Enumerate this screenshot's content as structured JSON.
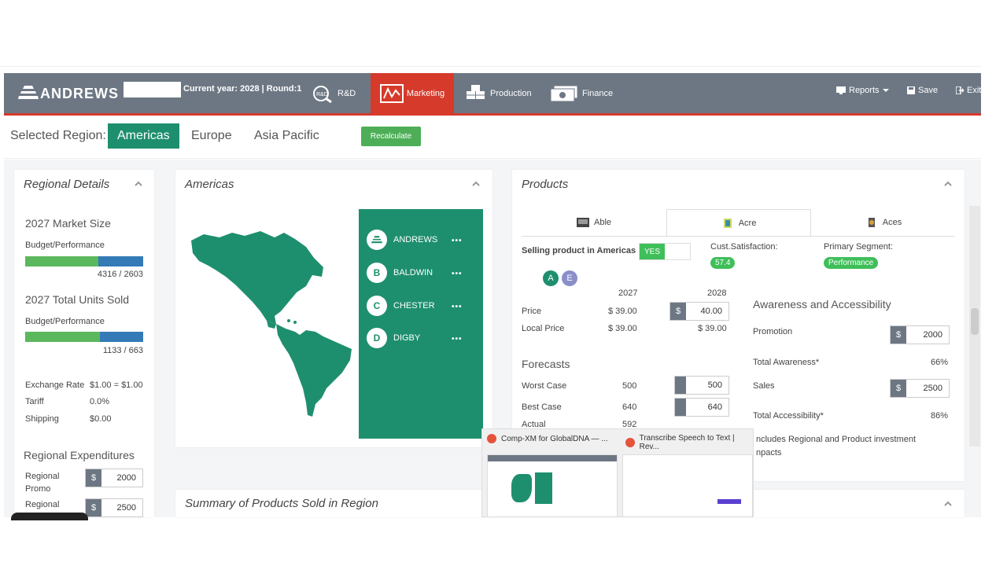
{
  "nav": {
    "logo": "ANDREWS",
    "current_year": "Current year: 2028 | Round:1",
    "items": [
      {
        "label": "R&D",
        "icon": "rd-icon"
      },
      {
        "label": "Marketing",
        "icon": "marketing-icon"
      },
      {
        "label": "Production",
        "icon": "boxes-icon"
      },
      {
        "label": "Finance",
        "icon": "money-icon"
      }
    ],
    "reports": "Reports",
    "save": "Save",
    "exit": "Exit",
    "brand_color": "#6d7784",
    "accent_color": "#d63a2a"
  },
  "region": {
    "label": "Selected Region:",
    "tabs": [
      "Americas",
      "Europe",
      "Asia Pacific"
    ],
    "active": "Americas",
    "recalculate": "Recalculate"
  },
  "regional_details": {
    "title": "Regional Details",
    "market_size_title": "2027 Market Size",
    "budget_label": "Budget/Performance",
    "market_size_value": "4316 / 2603",
    "market_size_fraction": 0.62,
    "units_title": "2027 Total Units Sold",
    "units_budget_label": "Budget/Performance",
    "units_value": "1133 / 663",
    "units_fraction": 0.63,
    "exchange_label": "Exchange Rate",
    "exchange_value": "$1.00 = $1.00",
    "tariff_label": "Tariff",
    "tariff_value": "0.0%",
    "shipping_label": "Shipping",
    "shipping_value": "$0.00",
    "expenditures_title": "Regional Expenditures",
    "promo_label": "Regional Promo",
    "promo_value": "2000",
    "sales_label": "Regional",
    "sales_value": "2500",
    "currency": "$"
  },
  "americas": {
    "title": "Americas",
    "competitors": [
      {
        "letter": "A",
        "name": "ANDREWS",
        "menu": "•••"
      },
      {
        "letter": "B",
        "name": "BALDWIN",
        "menu": "•••"
      },
      {
        "letter": "C",
        "name": "CHESTER",
        "menu": "•••"
      },
      {
        "letter": "D",
        "name": "DIGBY",
        "menu": "•••"
      }
    ]
  },
  "products": {
    "title": "Products",
    "tabs": [
      "Able",
      "Acre",
      "Aces"
    ],
    "active_tab": "Acre",
    "selling_label": "Selling product in Americas",
    "selling_value": "YES",
    "cust_label": "Cust.Satisfaction:",
    "cust_value": "57.4",
    "segment_label": "Primary Segment:",
    "segment_value": "Performance",
    "badges": [
      "A",
      "E"
    ],
    "year_prev": "2027",
    "year_next": "2028",
    "price_label": "Price",
    "price_prev": "$ 39.00",
    "price_next": "40.00",
    "local_label": "Local Price",
    "local_prev": "$ 39.00",
    "local_next": "$ 39.00",
    "forecasts_title": "Forecasts",
    "worst_label": "Worst Case",
    "worst_prev": "500",
    "worst_next": "500",
    "best_label": "Best Case",
    "best_prev": "640",
    "best_next": "640",
    "actual_label": "Actual",
    "actual_prev": "592",
    "aa_title": "Awareness and Accessibility",
    "promotion_label": "Promotion",
    "promotion_value": "2000",
    "awareness_label": "Total Awareness*",
    "awareness_value": "66%",
    "sales_label": "Sales",
    "sales_value": "2500",
    "accessibility_label": "Total Accessibility*",
    "accessibility_value": "86%",
    "note": "ncludes Regional and Product investment",
    "note2": "npacts",
    "currency": "$"
  },
  "summary": {
    "title": "Summary of Products Sold in Region"
  },
  "popup": {
    "tab1": "Comp-XM for GlobalDNA — ...",
    "tab2": "Transcribe Speech to Text | Rev..."
  }
}
